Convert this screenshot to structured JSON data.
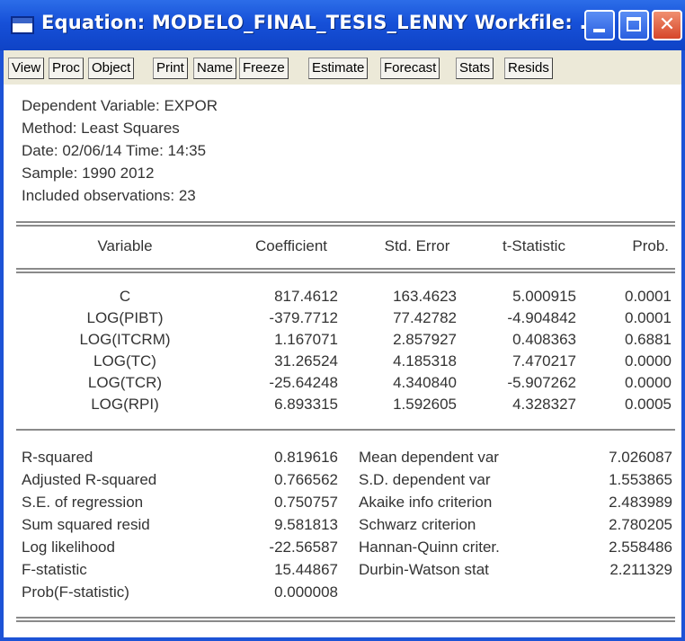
{
  "window": {
    "title": "Equation: MODELO_FINAL_TESIS_LENNY   Workfile: ..."
  },
  "toolbar": [
    "View",
    "Proc",
    "Object",
    "Print",
    "Name",
    "Freeze",
    "Estimate",
    "Forecast",
    "Stats",
    "Resids"
  ],
  "header": [
    "Dependent Variable: EXPOR",
    "Method: Least Squares",
    "Date: 02/06/14   Time: 14:35",
    "Sample: 1990 2012",
    "Included observations: 23"
  ],
  "table": {
    "columns": [
      "Variable",
      "Coefficient",
      "Std. Error",
      "t-Statistic",
      "Prob."
    ],
    "rows": [
      [
        "C",
        "817.4612",
        "163.4623",
        "5.000915",
        "0.0001"
      ],
      [
        "LOG(PIBT)",
        "-379.7712",
        "77.42782",
        "-4.904842",
        "0.0001"
      ],
      [
        "LOG(ITCRM)",
        "1.167071",
        "2.857927",
        "0.408363",
        "0.6881"
      ],
      [
        "LOG(TC)",
        "31.26524",
        "4.185318",
        "7.470217",
        "0.0000"
      ],
      [
        "LOG(TCR)",
        "-25.64248",
        "4.340840",
        "-5.907262",
        "0.0000"
      ],
      [
        "LOG(RPI)",
        "6.893315",
        "1.592605",
        "4.328327",
        "0.0005"
      ]
    ]
  },
  "stats": [
    [
      "R-squared",
      "0.819616",
      "Mean dependent var",
      "7.026087"
    ],
    [
      "Adjusted R-squared",
      "0.766562",
      "S.D. dependent var",
      "1.553865"
    ],
    [
      "S.E. of regression",
      "0.750757",
      "Akaike info criterion",
      "2.483989"
    ],
    [
      "Sum squared resid",
      "9.581813",
      "Schwarz criterion",
      "2.780205"
    ],
    [
      "Log likelihood",
      "-22.56587",
      "Hannan-Quinn criter.",
      "2.558486"
    ],
    [
      "F-statistic",
      "15.44867",
      "Durbin-Watson stat",
      "2.211329"
    ],
    [
      "Prob(F-statistic)",
      "0.000008",
      "",
      ""
    ]
  ]
}
